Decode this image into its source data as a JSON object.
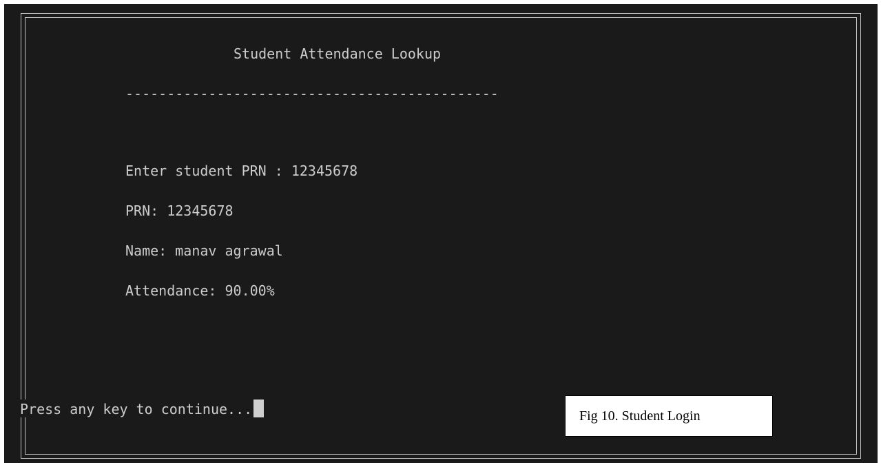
{
  "console": {
    "title": "Student Attendance Lookup",
    "separator": "---------------------------------------------",
    "prompt_line": "Enter student PRN : 12345678",
    "prn_line": "PRN: 12345678",
    "name_line": "Name: manav agrawal",
    "attendance_line": "Attendance: 90.00%",
    "continue_line": "Press any key to continue..."
  },
  "caption": {
    "text": "Fig 10. Student Login"
  },
  "colors": {
    "console_background": "#1a1a1a",
    "console_text": "#cccccc",
    "frame_border": "#c8c8c8"
  }
}
